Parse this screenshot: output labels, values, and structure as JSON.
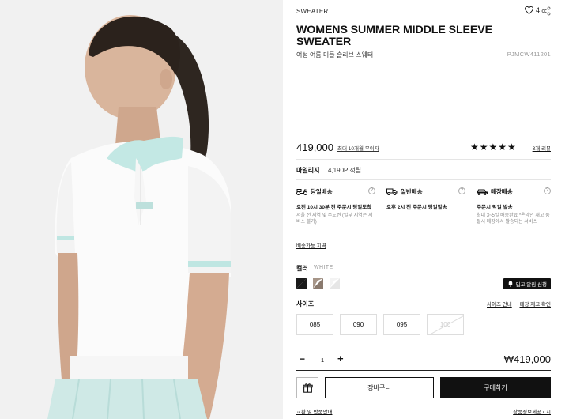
{
  "product": {
    "category": "SWEATER",
    "title": "WOMENS SUMMER MIDDLE SLEEVE SWEATER",
    "subtitle": "여성 여름 미들 슬리브 스웨터",
    "code": "PJMCW411201",
    "wish_count": "4",
    "image_alt": "Model wearing white short-sleeve knit polo with mint collar"
  },
  "price": {
    "amount": "419,000",
    "installment_label": "최대 10개월 무이자",
    "stars": "★★★★★",
    "rating": 5,
    "review_label": "3개 리뷰"
  },
  "mileage": {
    "label": "마일리지",
    "value": "4,190P 적립"
  },
  "shipping": [
    {
      "title": "당일배송",
      "main": "오전 10시 30분 전 주문시 당일도착",
      "sub": "서울 전 지역 및 수도권 (일부 지역은 서비스 불가)",
      "icon": "scooter-icon"
    },
    {
      "title": "일반배송",
      "main": "오후 2시 전 주문시 당일발송",
      "sub": "",
      "icon": "truck-icon"
    },
    {
      "title": "매장배송",
      "main": "주문시 익일 발송",
      "sub": "최대 3~5일 배송완료 *온라인 재고 품절시 매장에서 발송되는 서비스",
      "icon": "store-car-icon"
    }
  ],
  "shipping_link": "배송가능 지역",
  "color": {
    "label": "컬러",
    "selected": "WHITE",
    "swatches": [
      "#1a1a1a",
      "#8a7a6e",
      "#e6e6e6"
    ],
    "notify_label": "입고 알림 신청"
  },
  "size": {
    "label": "사이즈",
    "guide_label": "사이즈 안내",
    "stock_label": "매장 재고 확인",
    "options": [
      {
        "label": "085",
        "available": true
      },
      {
        "label": "090",
        "available": true
      },
      {
        "label": "095",
        "available": true
      },
      {
        "label": "100",
        "available": false
      }
    ]
  },
  "order": {
    "minus": "−",
    "quantity": "1",
    "plus": "+",
    "total": "₩419,000",
    "cart_label": "장바구니",
    "buy_label": "구매하기"
  },
  "footer": {
    "left_link": "교환 및 반품안내",
    "right_link": "상품정보제공고시"
  }
}
